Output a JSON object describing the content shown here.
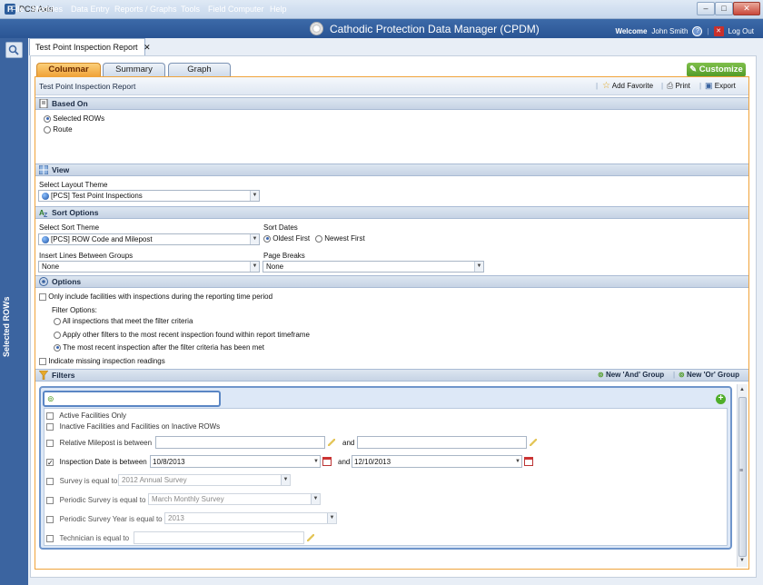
{
  "app": {
    "title": "PCS Axis",
    "header_title": "Cathodic Protection Data Manager (CPDM)",
    "welcome_label": "Welcome",
    "user_name": "John Smith",
    "logout_label": "Log Out"
  },
  "menu": [
    "File",
    "Modules",
    "Data Entry",
    "Reports / Graphs",
    "Tools",
    "Field Computer",
    "Help"
  ],
  "sidebar": {
    "vertical_label": "Selected ROWs"
  },
  "doc_tab": {
    "label": "Test Point Inspection Report",
    "close": "✕"
  },
  "view_tabs": [
    "Columnar",
    "Summary",
    "Graph"
  ],
  "customize_label": "Customize",
  "report": {
    "title": "Test Point Inspection Report",
    "add_favorite": "Add Favorite",
    "print": "Print",
    "export": "Export"
  },
  "based_on": {
    "header": "Based On",
    "options": [
      "Selected ROWs",
      "Route"
    ],
    "selected": "Selected ROWs"
  },
  "view": {
    "header": "View",
    "layout_label": "Select Layout Theme",
    "layout_value": "[PCS] Test Point Inspections"
  },
  "sort": {
    "header": "Sort Options",
    "theme_label": "Select Sort Theme",
    "theme_value": "[PCS] ROW Code and Milepost",
    "dates_label": "Sort Dates",
    "oldest": "Oldest First",
    "newest": "Newest First",
    "lines_label": "Insert Lines Between Groups",
    "lines_value": "None",
    "breaks_label": "Page Breaks",
    "breaks_value": "None"
  },
  "options": {
    "header": "Options",
    "only_include": "Only include facilities with inspections during the reporting time period",
    "filter_options_label": "Filter Options:",
    "radio1": "All inspections that meet the filter criteria",
    "radio2": "Apply other filters to the most recent inspection found within report timeframe",
    "radio3": "The most recent inspection after the filter criteria has been met",
    "indicate_missing": "Indicate missing inspection readings"
  },
  "filters": {
    "header": "Filters",
    "new_and": "New 'And' Group",
    "new_or": "New 'Or' Group",
    "rows": {
      "active": "Active Facilities Only",
      "inactive": "Inactive Facilities and Facilities on Inactive ROWs",
      "milepost": "Relative Milepost is between",
      "and1": "and",
      "inspection_date": "Inspection Date is between",
      "date_from": "10/8/2013",
      "and2": "and",
      "date_to": "12/10/2013",
      "survey": "Survey is equal to",
      "survey_value": "2012 Annual Survey",
      "periodic": "Periodic Survey is equal to",
      "periodic_value": "March Monthly Survey",
      "periodic_year": "Periodic Survey Year is equal to",
      "periodic_year_value": "2013",
      "technician": "Technician is equal to"
    }
  },
  "colors": {
    "menubar": "#2a5594",
    "accent_orange": "#f0a33a",
    "customize_green": "#4f9a26"
  }
}
